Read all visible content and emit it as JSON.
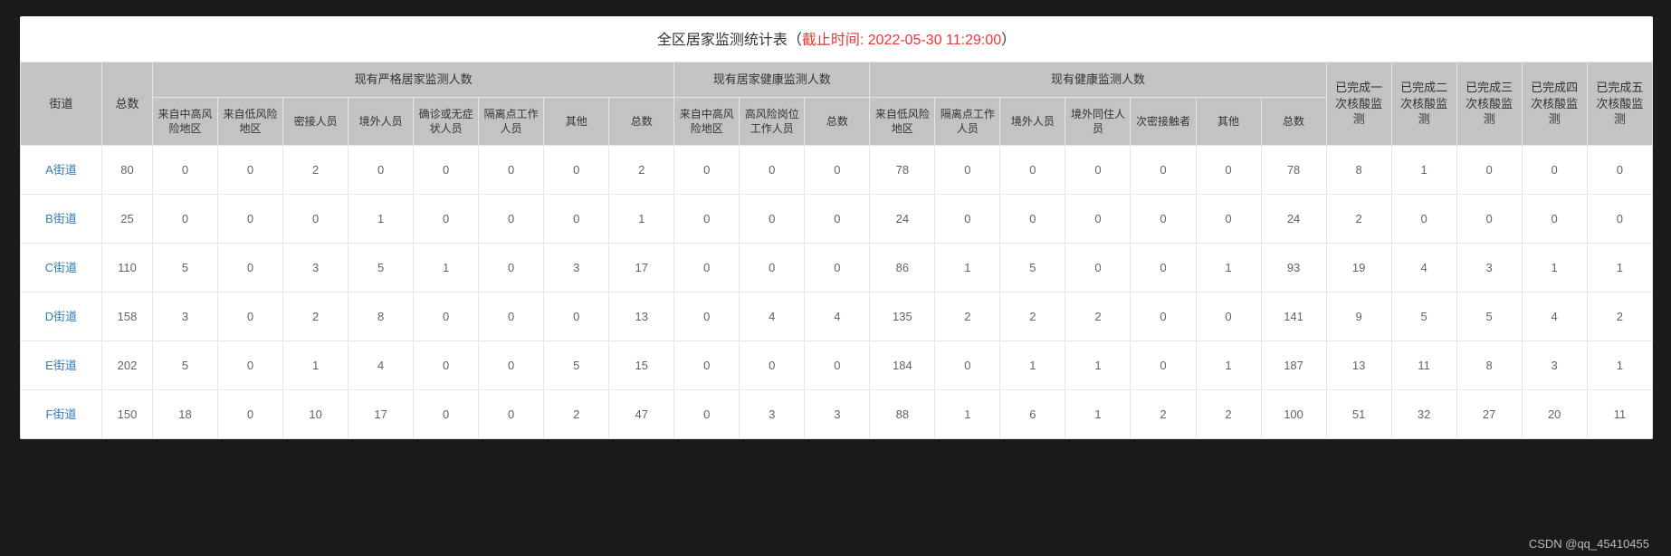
{
  "title_prefix": "全区居家监测统计表（",
  "title_ts_label": "截止时间: 2022-05-30  11:29:00",
  "title_suffix": "）",
  "watermark": "CSDN @qq_45410455",
  "header": {
    "street": "街道",
    "total": "总数",
    "g1": "现有严格居家监测人数",
    "g2": "现有居家健康监测人数",
    "g3": "现有健康监测人数",
    "g1cols": [
      "来自中高风险地区",
      "来自低风险地区",
      "密接人员",
      "境外人员",
      "确诊或无症状人员",
      "隔离点工作人员",
      "其他",
      "总数"
    ],
    "g2cols": [
      "来自中高风险地区",
      "高风险岗位工作人员",
      "总数"
    ],
    "g3cols": [
      "来自低风险地区",
      "隔离点工作人员",
      "境外人员",
      "境外同住人员",
      "次密接触者",
      "其他",
      "总数"
    ],
    "tail": [
      "已完成一次核酸监测",
      "已完成二次核酸监测",
      "已完成三次核酸监测",
      "已完成四次核酸监测",
      "已完成五次核酸监测"
    ]
  },
  "rows": [
    {
      "street": "A街道",
      "total": 80,
      "g1": [
        0,
        0,
        2,
        0,
        0,
        0,
        0,
        2
      ],
      "g2": [
        0,
        0,
        0
      ],
      "g3": [
        78,
        0,
        0,
        0,
        0,
        0,
        78
      ],
      "tail": [
        8,
        1,
        0,
        0,
        0
      ]
    },
    {
      "street": "B街道",
      "total": 25,
      "g1": [
        0,
        0,
        0,
        1,
        0,
        0,
        0,
        1
      ],
      "g2": [
        0,
        0,
        0
      ],
      "g3": [
        24,
        0,
        0,
        0,
        0,
        0,
        24
      ],
      "tail": [
        2,
        0,
        0,
        0,
        0
      ]
    },
    {
      "street": "C街道",
      "total": 110,
      "g1": [
        5,
        0,
        3,
        5,
        1,
        0,
        3,
        17
      ],
      "g2": [
        0,
        0,
        0
      ],
      "g3": [
        86,
        1,
        5,
        0,
        0,
        1,
        93
      ],
      "tail": [
        19,
        4,
        3,
        1,
        1
      ]
    },
    {
      "street": "D街道",
      "total": 158,
      "g1": [
        3,
        0,
        2,
        8,
        0,
        0,
        0,
        13
      ],
      "g2": [
        0,
        4,
        4
      ],
      "g3": [
        135,
        2,
        2,
        2,
        0,
        0,
        141
      ],
      "tail": [
        9,
        5,
        5,
        4,
        2
      ]
    },
    {
      "street": "E街道",
      "total": 202,
      "g1": [
        5,
        0,
        1,
        4,
        0,
        0,
        5,
        15
      ],
      "g2": [
        0,
        0,
        0
      ],
      "g3": [
        184,
        0,
        1,
        1,
        0,
        1,
        187
      ],
      "tail": [
        13,
        11,
        8,
        3,
        1
      ]
    },
    {
      "street": "F街道",
      "total": 150,
      "g1": [
        18,
        0,
        10,
        17,
        0,
        0,
        2,
        47
      ],
      "g2": [
        0,
        3,
        3
      ],
      "g3": [
        88,
        1,
        6,
        1,
        2,
        2,
        100
      ],
      "tail": [
        51,
        32,
        27,
        20,
        11
      ]
    }
  ],
  "chart_data": {
    "type": "table",
    "title": "全区居家监测统计表（截止时间: 2022-05-30 11:29:00）",
    "columns": [
      "街道",
      "总数",
      "严格-来自中高风险地区",
      "严格-来自低风险地区",
      "严格-密接人员",
      "严格-境外人员",
      "严格-确诊或无症状人员",
      "严格-隔离点工作人员",
      "严格-其他",
      "严格-总数",
      "健康-来自中高风险地区",
      "健康-高风险岗位工作人员",
      "健康-总数",
      "监测-来自低风险地区",
      "监测-隔离点工作人员",
      "监测-境外人员",
      "监测-境外同住人员",
      "监测-次密接触者",
      "监测-其他",
      "监测-总数",
      "已完成一次核酸监测",
      "已完成二次核酸监测",
      "已完成三次核酸监测",
      "已完成四次核酸监测",
      "已完成五次核酸监测"
    ],
    "data": [
      [
        "A街道",
        80,
        0,
        0,
        2,
        0,
        0,
        0,
        0,
        2,
        0,
        0,
        0,
        78,
        0,
        0,
        0,
        0,
        0,
        78,
        8,
        1,
        0,
        0,
        0
      ],
      [
        "B街道",
        25,
        0,
        0,
        0,
        1,
        0,
        0,
        0,
        1,
        0,
        0,
        0,
        24,
        0,
        0,
        0,
        0,
        0,
        24,
        2,
        0,
        0,
        0,
        0
      ],
      [
        "C街道",
        110,
        5,
        0,
        3,
        5,
        1,
        0,
        3,
        17,
        0,
        0,
        0,
        86,
        1,
        5,
        0,
        0,
        1,
        93,
        19,
        4,
        3,
        1,
        1
      ],
      [
        "D街道",
        158,
        3,
        0,
        2,
        8,
        0,
        0,
        0,
        13,
        0,
        4,
        4,
        135,
        2,
        2,
        2,
        0,
        0,
        141,
        9,
        5,
        5,
        4,
        2
      ],
      [
        "E街道",
        202,
        5,
        0,
        1,
        4,
        0,
        0,
        5,
        15,
        0,
        0,
        0,
        184,
        0,
        1,
        1,
        0,
        1,
        187,
        13,
        11,
        8,
        3,
        1
      ],
      [
        "F街道",
        150,
        18,
        0,
        10,
        17,
        0,
        0,
        2,
        47,
        0,
        3,
        3,
        88,
        1,
        6,
        1,
        2,
        2,
        100,
        51,
        32,
        27,
        20,
        11
      ]
    ]
  }
}
